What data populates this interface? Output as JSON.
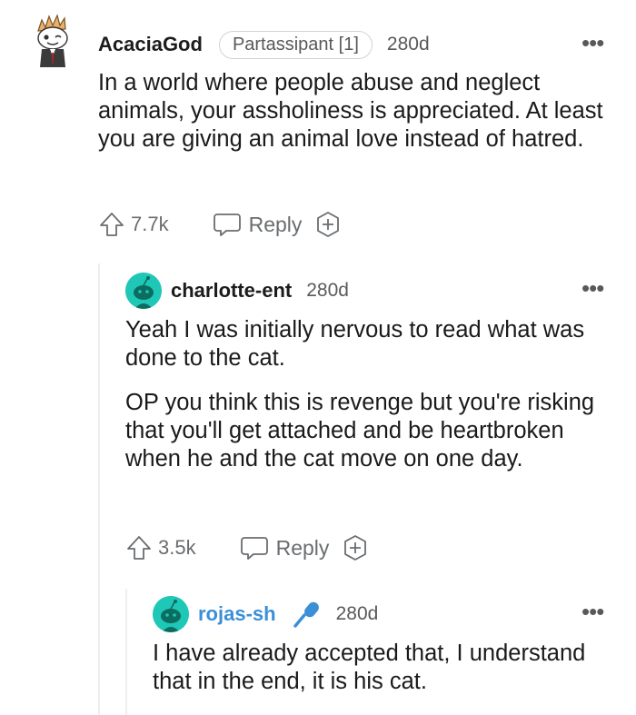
{
  "comments": [
    {
      "username": "AcaciaGod",
      "flair": "Partassipant [1]",
      "age": "280d",
      "paragraphs": [
        "In a world where people abuse and neglect animals, your assholiness is appreciated. At least you are giving an animal love instead of hatred."
      ],
      "upvotes": "7.7k",
      "reply_label": "Reply",
      "more_icon": "ellipsis-icon"
    },
    {
      "username": "charlotte-ent",
      "age": "280d",
      "paragraphs": [
        "Yeah I was initially nervous to read what was done to the cat.",
        "OP you think this is revenge but you're risking that you'll get attached and be heartbroken when he and the cat move on one day."
      ],
      "upvotes": "3.5k",
      "reply_label": "Reply",
      "more_icon": "ellipsis-icon"
    },
    {
      "username": "rojas-sh",
      "age": "280d",
      "user_badge_icon": "microphone-icon",
      "paragraphs": [
        "I have already accepted that, I understand that in the end, it is his cat."
      ],
      "more_icon": "ellipsis-icon"
    }
  ],
  "colors": {
    "text": "#1a1a1b",
    "meta": "#58595b",
    "thread_line": "#edeff1",
    "op_username": "#3a8fd6",
    "avatar_teal": "#1fc7b6"
  }
}
